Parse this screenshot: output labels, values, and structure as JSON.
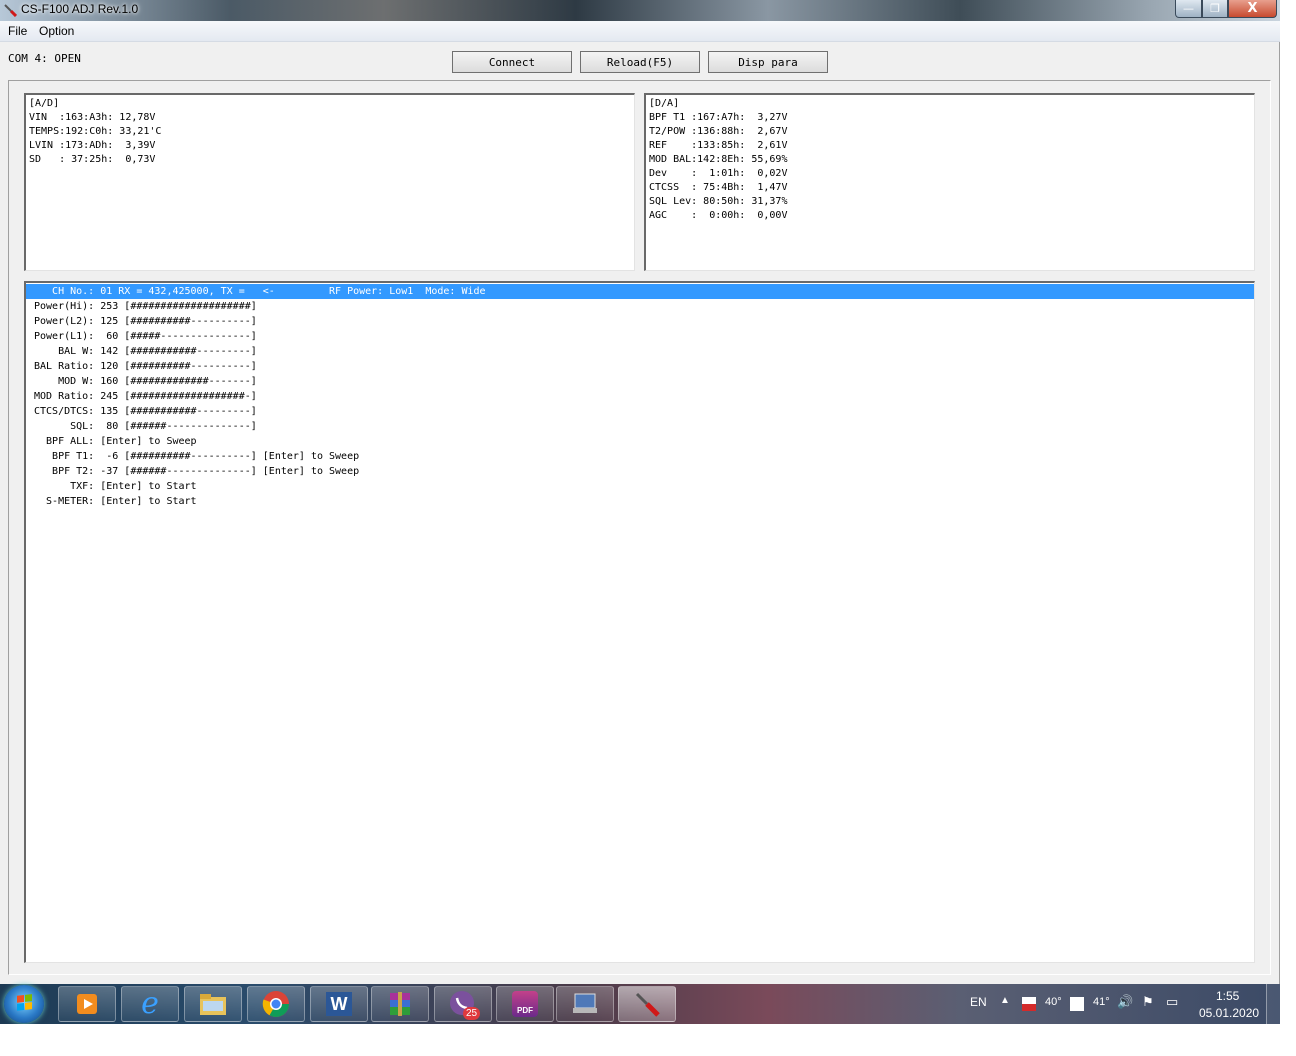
{
  "window": {
    "title": "CS-F100 ADJ Rev.1.0",
    "controls": {
      "minimize": "—",
      "maximize": "❐",
      "close": "X"
    }
  },
  "menu": {
    "file": "File",
    "option": "Option"
  },
  "status": {
    "com": "COM 4: OPEN"
  },
  "toolbar": {
    "connect": "Connect",
    "reload": "Reload(F5)",
    "disp_para": "Disp para"
  },
  "ad_panel": {
    "lines": [
      "[A/D]",
      "VIN  :163:A3h: 12,78V",
      "TEMPS:192:C0h: 33,21'C",
      "LVIN :173:ADh:  3,39V",
      "SD   : 37:25h:  0,73V"
    ]
  },
  "da_panel": {
    "lines": [
      "[D/A]",
      "BPF T1 :167:A7h:  3,27V",
      "T2/POW :136:88h:  2,67V",
      "REF    :133:85h:  2,61V",
      "MOD BAL:142:8Eh: 55,69%",
      "Dev    :  1:01h:  0,02V",
      "CTCSS  : 75:4Bh:  1,47V",
      "SQL Lev: 80:50h: 31,37%",
      "AGC    :  0:00h:  0,00V"
    ]
  },
  "main_panel": {
    "header": "   CH No.: 01 RX = 432,425000, TX =   <-         RF Power: Low1  Mode: Wide",
    "rows": [
      "Power(Hi): 253 [####################]",
      "Power(L2): 125 [##########----------]",
      "Power(L1):  60 [#####---------------]",
      "    BAL W: 142 [###########---------]",
      "BAL Ratio: 120 [##########----------]",
      "    MOD W: 160 [#############-------]",
      "MOD Ratio: 245 [###################-]",
      "CTCS/DTCS: 135 [###########---------]",
      "      SQL:  80 [######--------------]",
      "  BPF ALL: [Enter] to Sweep",
      "   BPF T1:  -6 [##########----------] [Enter] to Sweep",
      "   BPF T2: -37 [######--------------] [Enter] to Sweep",
      "      TXF: [Enter] to Start",
      "  S-METER: [Enter] to Start"
    ]
  },
  "taskbar": {
    "apps": [
      {
        "name": "media-player-icon"
      },
      {
        "name": "internet-explorer-icon",
        "glyph": "e"
      },
      {
        "name": "file-explorer-icon"
      },
      {
        "name": "chrome-icon"
      },
      {
        "name": "word-icon",
        "glyph": "W"
      },
      {
        "name": "winrar-icon"
      },
      {
        "name": "viber-icon",
        "badge": "25"
      },
      {
        "name": "pdf-app-icon",
        "glyph": "PDF"
      },
      {
        "name": "computer-tools-icon"
      },
      {
        "name": "cs-f100-adj-icon"
      }
    ],
    "tray": {
      "lang": "EN",
      "temp1": "40°",
      "temp2": "41°",
      "time": "1:55",
      "date": "05.01.2020"
    }
  },
  "colors": {
    "selection": "#3399ff",
    "window_bg": "#f0f0f0",
    "panel_bg": "#ffffff"
  }
}
